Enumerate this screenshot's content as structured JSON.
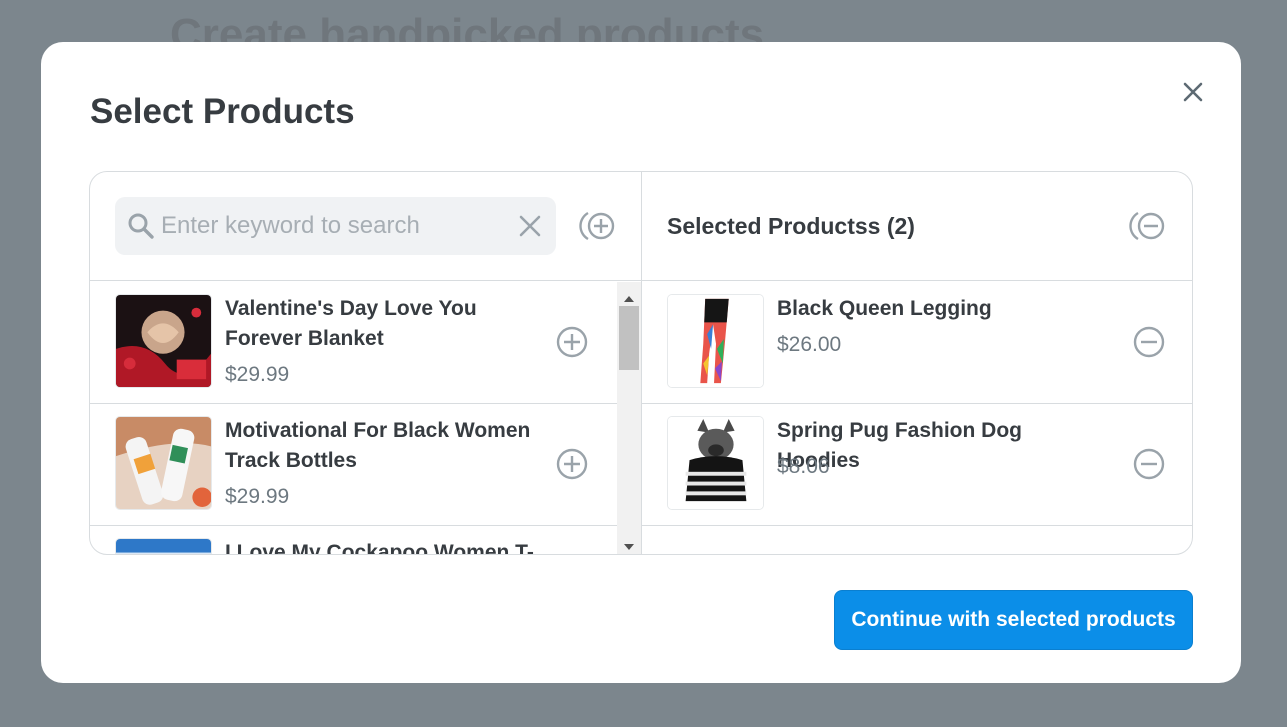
{
  "background": {
    "page_title": "Create handpicked products"
  },
  "modal": {
    "title": "Select Products",
    "close_icon": "close-icon"
  },
  "search": {
    "placeholder": "Enter keyword to search",
    "value": ""
  },
  "available_products": [
    {
      "name": "Valentine's Day Love You Forever Blanket",
      "price": "$29.99",
      "thumbnail": "blanket-image"
    },
    {
      "name": "Motivational For Black Women Track Bottles",
      "price": "$29.99",
      "thumbnail": "bottles-image"
    },
    {
      "name": "I Love My Cockapoo Women T-",
      "price": "",
      "thumbnail": "tshirt-size-chart-image"
    }
  ],
  "selected": {
    "heading": "Selected Productss (2)",
    "products": [
      {
        "name": "Black Queen Legging",
        "price": "$26.00",
        "thumbnail": "legging-image"
      },
      {
        "name": "Spring Pug Fashion Dog Hoodies",
        "price": "$8.06",
        "thumbnail": "dog-hoodie-image"
      }
    ]
  },
  "footer": {
    "continue_label": "Continue with selected products"
  },
  "colors": {
    "accent": "#0b8ee8",
    "overlay": "#7c868d",
    "text": "#373c41",
    "muted": "#6d7880",
    "border": "#d8dcdf"
  }
}
